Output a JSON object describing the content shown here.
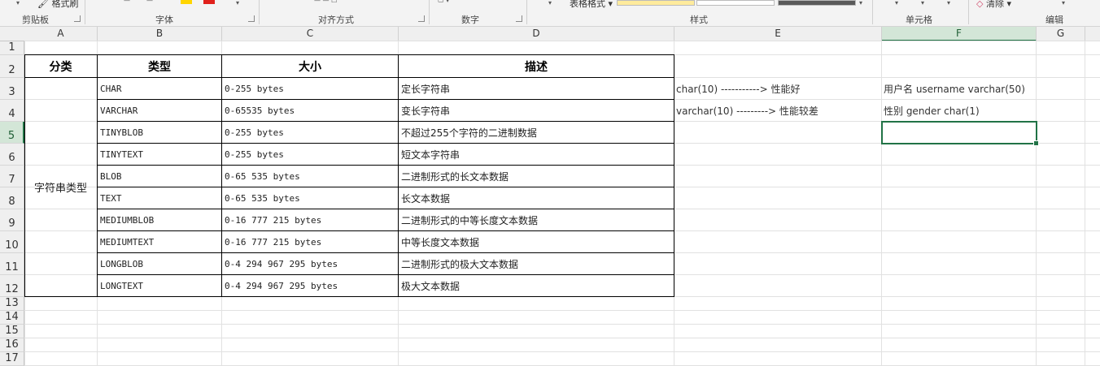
{
  "ribbon": {
    "format_painter": "格式刷",
    "table_format": "表格格式",
    "clear": "清除",
    "groups": {
      "clipboard": "剪贴板",
      "font": "字体",
      "alignment": "对齐方式",
      "number": "数字",
      "styles": "样式",
      "cells": "单元格",
      "editing": "编辑"
    },
    "colors": {
      "highlight": "#FFD500",
      "font_red": "#E0201B",
      "accent": "#217346"
    }
  },
  "columns": [
    "A",
    "B",
    "C",
    "D",
    "E",
    "F",
    "G"
  ],
  "selected_column": "F",
  "rows": [
    "1",
    "2",
    "3",
    "4",
    "5",
    "6",
    "7",
    "8",
    "9",
    "10",
    "11",
    "12",
    "13",
    "14",
    "15",
    "16",
    "17"
  ],
  "selected_row": "5",
  "table": {
    "headers": {
      "category": "分类",
      "type": "类型",
      "size": "大小",
      "description": "描述"
    },
    "category": "字符串类型",
    "records": [
      {
        "type": "CHAR",
        "size": "0-255 bytes",
        "desc": "定长字符串"
      },
      {
        "type": "VARCHAR",
        "size": "0-65535 bytes",
        "desc": "变长字符串"
      },
      {
        "type": "TINYBLOB",
        "size": "0-255 bytes",
        "desc": "不超过255个字符的二进制数据"
      },
      {
        "type": "TINYTEXT",
        "size": "0-255 bytes",
        "desc": "短文本字符串"
      },
      {
        "type": "BLOB",
        "size": "0-65 535 bytes",
        "desc": "二进制形式的长文本数据"
      },
      {
        "type": "TEXT",
        "size": "0-65 535 bytes",
        "desc": "长文本数据"
      },
      {
        "type": "MEDIUMBLOB",
        "size": "0-16 777 215 bytes",
        "desc": "二进制形式的中等长度文本数据"
      },
      {
        "type": "MEDIUMTEXT",
        "size": "0-16 777 215 bytes",
        "desc": "中等长度文本数据"
      },
      {
        "type": "LONGBLOB",
        "size": "0-4 294 967 295 bytes",
        "desc": "二进制形式的极大文本数据"
      },
      {
        "type": "LONGTEXT",
        "size": "0-4 294 967 295 bytes",
        "desc": "极大文本数据"
      }
    ]
  },
  "notes": {
    "e3": "char(10) -----------> 性能好",
    "e4": "varchar(10) ---------> 性能较差",
    "f3": "用户名  username  varchar(50)",
    "f4": "性别  gender  char(1)"
  }
}
